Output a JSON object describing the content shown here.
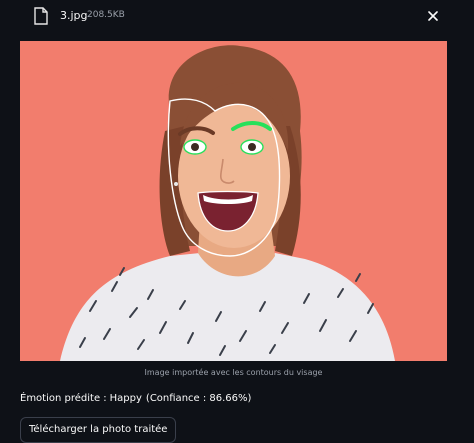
{
  "uploaded_file": {
    "name": "3.jpg",
    "size": "208.5KB",
    "file_icon": "file-icon",
    "close_icon": "close-icon"
  },
  "image": {
    "caption": "Image importée avec les contours du visage",
    "background_color": "#f27d6d",
    "contour_color": "#ffffff",
    "feature_highlight_color": "#27e05a"
  },
  "result": {
    "label": "Émotion prédite :",
    "emotion": "Happy",
    "confidence": "(Confiance : 86.66%)"
  },
  "download_button": {
    "label": "Télécharger la photo traitée"
  }
}
